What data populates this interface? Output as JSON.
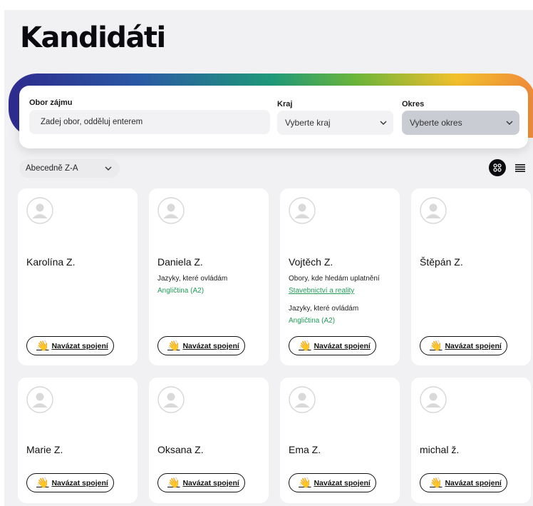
{
  "page": {
    "title": "Kandidáti"
  },
  "filters": {
    "field": {
      "label": "Obor zájmu",
      "placeholder": "Zadej obor, odděluj enterem",
      "value": ""
    },
    "region": {
      "label": "Kraj",
      "selected": "Vyberte kraj"
    },
    "district": {
      "label": "Okres",
      "selected": "Vyberte okres"
    }
  },
  "sort": {
    "selected": "Abecedně Z-A"
  },
  "view": {
    "active": "grid",
    "grid_icon": "grid-icon",
    "list_icon": "list-icon"
  },
  "colors": {
    "accent_green": "#1f9d57",
    "dark": "#0b0b0f"
  },
  "candidates": [
    {
      "name": "Karolína Z.",
      "connect_label": "Navázat spojení"
    },
    {
      "name": "Daniela Z.",
      "languages_label": "Jazyky, které ovládám",
      "languages": "Angličtina (A2)",
      "connect_label": "Navázat spojení"
    },
    {
      "name": "Vojtěch Z.",
      "fields_label": "Obory, kde hledám uplatnění",
      "fields": "Stavebnictví a reality",
      "languages_label": "Jazyky, které ovládám",
      "languages": "Angličtina (A2)",
      "connect_label": "Navázat spojení"
    },
    {
      "name": "Štěpán Z.",
      "connect_label": "Navázat spojení"
    },
    {
      "name": "Marie Z.",
      "connect_label": "Navázat spojení"
    },
    {
      "name": "Oksana Z.",
      "connect_label": "Navázat spojení"
    },
    {
      "name": "Ema Z.",
      "connect_label": "Navázat spojení"
    },
    {
      "name": "michal ž.",
      "connect_label": "Navázat spojení"
    }
  ]
}
